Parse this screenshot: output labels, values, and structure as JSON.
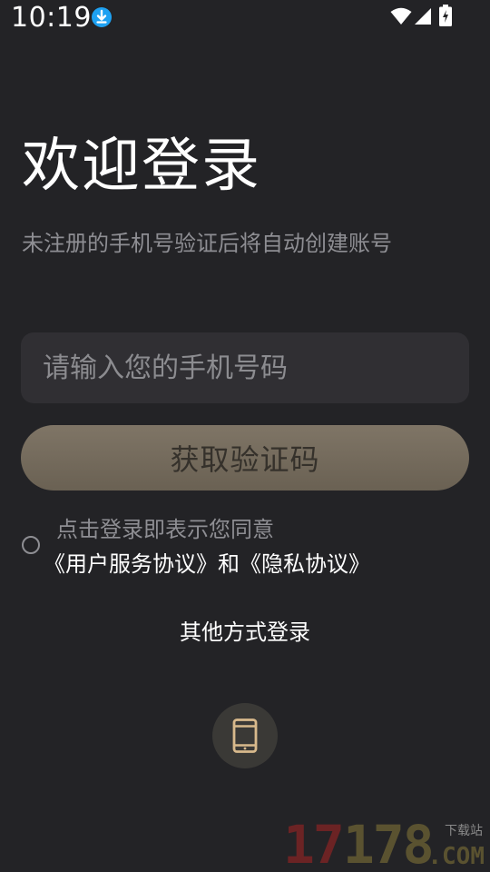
{
  "status_bar": {
    "time": "10:19",
    "icons": [
      "download-icon",
      "wifi-icon",
      "signal-icon",
      "battery-charging-icon"
    ]
  },
  "header": {
    "title": "欢迎登录",
    "subtitle": "未注册的手机号验证后将自动创建账号"
  },
  "form": {
    "phone_placeholder": "请输入您的手机号码",
    "phone_value": "",
    "get_code_label": "获取验证码"
  },
  "agreement": {
    "checked": false,
    "prefix": "点击登录即表示您同意",
    "user_agreement": "《用户服务协议》",
    "conjunction": "和",
    "privacy_policy": "《隐私协议》"
  },
  "other_login": {
    "title": "其他方式登录",
    "methods": [
      "phone-icon"
    ]
  },
  "watermark": {
    "digits_red": "17",
    "digits_gold": "178",
    "site_label": "下载站",
    "domain": ".COM"
  },
  "colors": {
    "background": "#232326",
    "input_bg": "#302f33",
    "button_bg": "#7a7061",
    "button_text": "#35312b",
    "muted_text": "#8e8e93",
    "accent_icon": "#d8b98c"
  }
}
